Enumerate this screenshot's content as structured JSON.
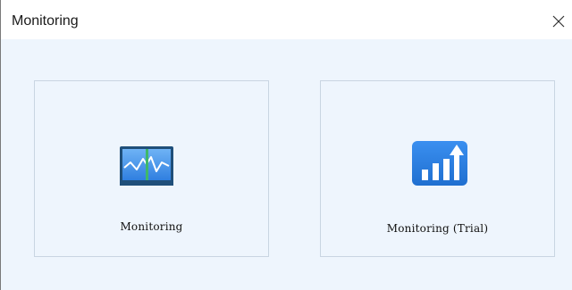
{
  "window": {
    "title": "Monitoring"
  },
  "cards": [
    {
      "label": "Monitoring",
      "icon": "monitor-waveform-icon"
    },
    {
      "label": "Monitoring (Trial)",
      "icon": "bar-chart-up-arrow-icon"
    }
  ],
  "colors": {
    "content_bg": "#eef5fd",
    "card_border": "#c9d5e2",
    "icon_blue": "#2f7fe0",
    "icon_dark": "#1f4f7a",
    "icon_green": "#3fb86a"
  }
}
